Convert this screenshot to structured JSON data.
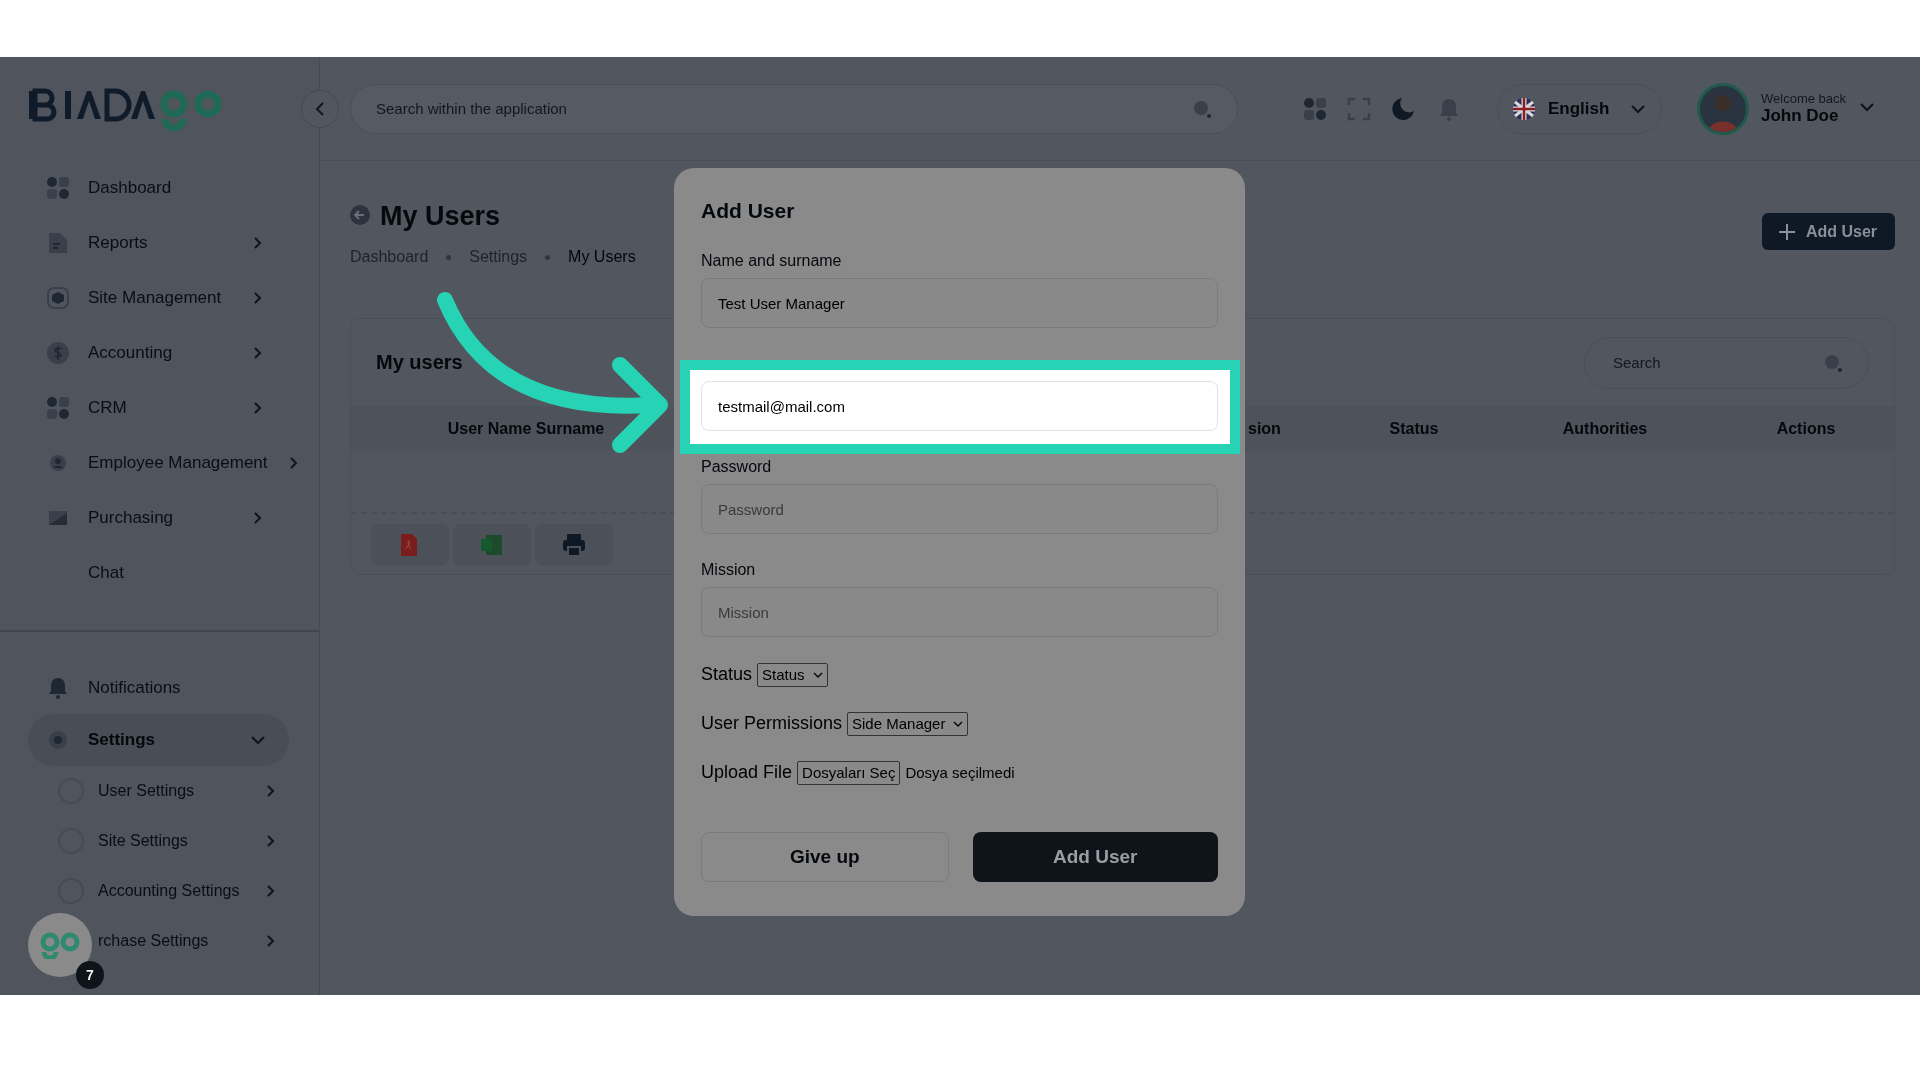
{
  "header": {
    "search_placeholder": "Search within the application",
    "language": "English",
    "welcome": "Welcome back",
    "user_name": "John Doe"
  },
  "sidebar": {
    "items": [
      {
        "label": "Dashboard",
        "expandable": false
      },
      {
        "label": "Reports",
        "expandable": true
      },
      {
        "label": "Site Management",
        "expandable": true
      },
      {
        "label": "Accounting",
        "expandable": true
      },
      {
        "label": "CRM",
        "expandable": true
      },
      {
        "label": "Employee Management",
        "expandable": true
      },
      {
        "label": "Purchasing",
        "expandable": true
      },
      {
        "label": "Chat",
        "expandable": false
      }
    ],
    "bottom_items": [
      {
        "label": "Notifications",
        "expandable": false,
        "selected": false
      },
      {
        "label": "Settings",
        "expandable": true,
        "selected": true,
        "expanded": true,
        "children": [
          {
            "label": "User Settings"
          },
          {
            "label": "Site Settings"
          },
          {
            "label": "Accounting Settings"
          },
          {
            "label": "rchase Settings"
          }
        ]
      }
    ]
  },
  "page": {
    "title": "My Users",
    "breadcrumb": [
      {
        "label": "Dashboard",
        "current": false
      },
      {
        "label": "Settings",
        "current": false
      },
      {
        "label": "My Users",
        "current": true
      }
    ],
    "add_button": "Add User"
  },
  "card": {
    "title": "My users",
    "search_placeholder": "Search",
    "columns": [
      "User Name Surname",
      "sion",
      "Status",
      "Authorities",
      "Actions"
    ]
  },
  "modal": {
    "title": "Add User",
    "fields": [
      {
        "label": "Name and surname",
        "value": "Test User Manager",
        "highlighted": false
      },
      {
        "value": "testmail@mail.com",
        "highlighted": true
      },
      {
        "label": "Password",
        "placeholder": "Password",
        "highlighted": false
      },
      {
        "label": "Mission",
        "placeholder": "Mission",
        "highlighted": false
      }
    ],
    "status": {
      "label": "Status",
      "value": "Status"
    },
    "permissions": {
      "label": "User Permissions",
      "value": "Side Manager"
    },
    "upload": {
      "label": "Upload File",
      "button": "Dosyaları Seç",
      "note": "Dosya seçilmedi"
    },
    "buttons": [
      {
        "label": "Give up",
        "kind": "secondary"
      },
      {
        "label": "Add User",
        "kind": "primary"
      }
    ]
  },
  "chat_bubble": {
    "badge": "7"
  }
}
